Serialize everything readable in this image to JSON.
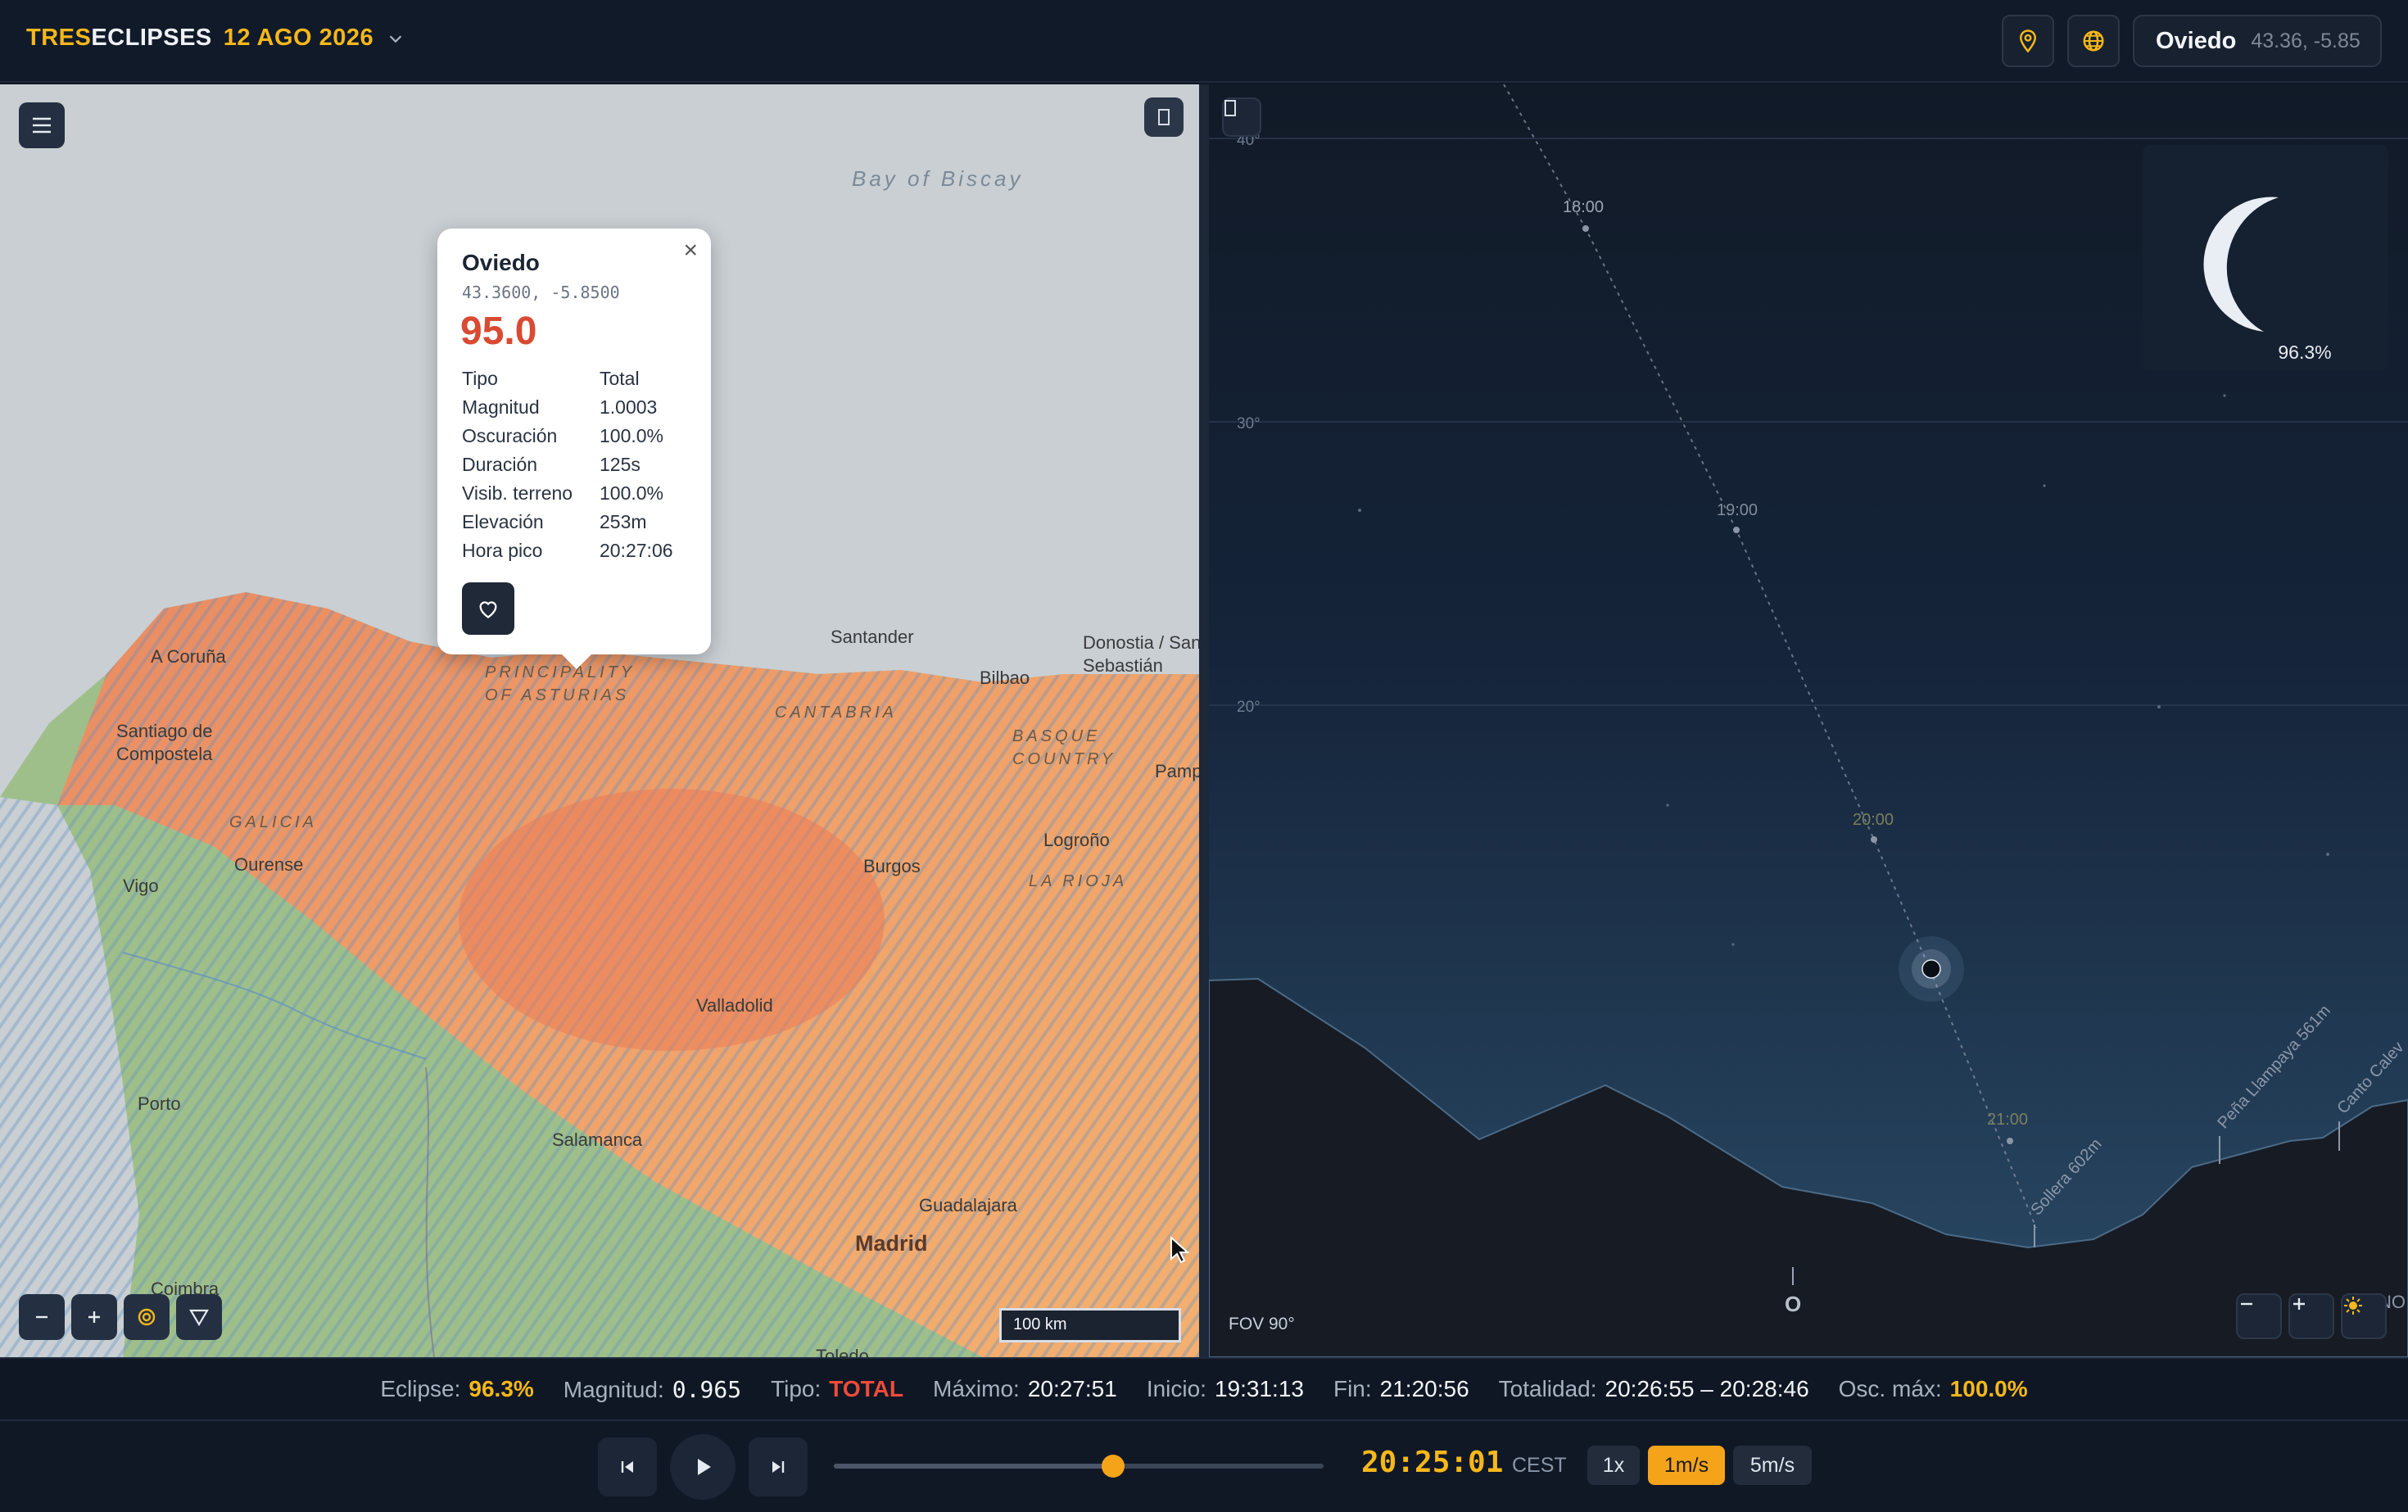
{
  "header": {
    "brand_part1": "TRES",
    "brand_part2": "ECLIPSES",
    "date": "12 AGO 2026",
    "location_name": "Oviedo",
    "location_coords": "43.36, -5.85"
  },
  "map": {
    "sea_label": "Bay of Biscay",
    "cities": [
      "A Coruña",
      "Santiago de Compostela",
      "Vigo",
      "Ourense",
      "Porto",
      "Salamanca",
      "Valladolid",
      "Burgos",
      "Logroño",
      "Santander",
      "Bilbao",
      "Donostia / San Sebastián",
      "Pamplona",
      "Guadalajara",
      "Madrid",
      "Coimbra",
      "Toledo"
    ],
    "regions": [
      "PRINCIPALITY OF ASTURIAS",
      "CANTABRIA",
      "BASQUE COUNTRY",
      "GALICIA",
      "LA RIOJA"
    ],
    "scale_label": "100 km"
  },
  "popup": {
    "name": "Oviedo",
    "coords": "43.3600, -5.8500",
    "score": "95.0",
    "close": "×",
    "rows": [
      {
        "k": "Tipo",
        "v": "Total"
      },
      {
        "k": "Magnitud",
        "v": "1.0003"
      },
      {
        "k": "Oscuración",
        "v": "100.0%"
      },
      {
        "k": "Duración",
        "v": "125s"
      },
      {
        "k": "Visib. terreno",
        "v": "100.0%"
      },
      {
        "k": "Elevación",
        "v": "253m"
      },
      {
        "k": "Hora pico",
        "v": "20:27:06"
      }
    ]
  },
  "sky": {
    "altitude_labels": [
      "40°",
      "30°",
      "20°"
    ],
    "time_labels": [
      "18:00",
      "19:00",
      "20:00",
      "21:00"
    ],
    "peaks": [
      "Sollera 602m",
      "Peña Llampaya 561m",
      "Canto Calev"
    ],
    "compass": [
      "O",
      "NO"
    ],
    "inset_percent": "96.3%",
    "fov": "FOV 90°"
  },
  "info": {
    "eclipse_label": "Eclipse:",
    "eclipse_value": "96.3%",
    "magnitud_label": "Magnitud:",
    "magnitud_value": "0.965",
    "tipo_label": "Tipo:",
    "tipo_value": "TOTAL",
    "maximo_label": "Máximo:",
    "maximo_value": "20:27:51",
    "inicio_label": "Inicio:",
    "inicio_value": "19:31:13",
    "fin_label": "Fin:",
    "fin_value": "21:20:56",
    "totalidad_label": "Totalidad:",
    "totalidad_value": "20:26:55 – 20:28:46",
    "osc_label": "Osc. máx:",
    "osc_value": "100.0%"
  },
  "playback": {
    "time": "20:25:01",
    "timezone": "CEST",
    "progress": 0.57,
    "speeds": [
      "1x",
      "1m/s",
      "5m/s"
    ],
    "active_speed": "1m/s"
  },
  "colors": {
    "accent": "#f5b71a",
    "score_red": "#d94a33",
    "tipo_red": "#ef4b3a"
  }
}
